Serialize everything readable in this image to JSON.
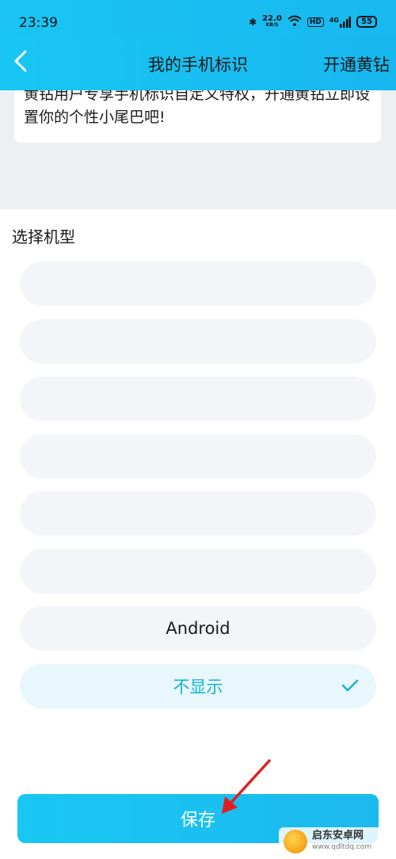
{
  "status_bar": {
    "time": "23:39",
    "speed_value": "22.0",
    "speed_unit": "KB/S",
    "hd_label": "HD",
    "network_label": "4G",
    "battery": "55"
  },
  "nav": {
    "title": "我的手机标识",
    "right_action": "开通黄钻"
  },
  "promo_text": "黄钻用户专享手机标识自定义特权，开通黄钻立即设置你的个性小尾巴吧!",
  "section_title": "选择机型",
  "options": [
    {
      "label": ""
    },
    {
      "label": ""
    },
    {
      "label": ""
    },
    {
      "label": ""
    },
    {
      "label": ""
    },
    {
      "label": ""
    },
    {
      "label": "Android"
    },
    {
      "label": "不显示",
      "selected": true
    }
  ],
  "save_label": "保存",
  "watermark": {
    "name": "启东安卓网",
    "url": "www.qdltdq.com"
  },
  "colors": {
    "accent": "#18bfef",
    "selected_text": "#14b2d4",
    "option_bg": "#f4f5f9",
    "arrow": "#e02020"
  }
}
